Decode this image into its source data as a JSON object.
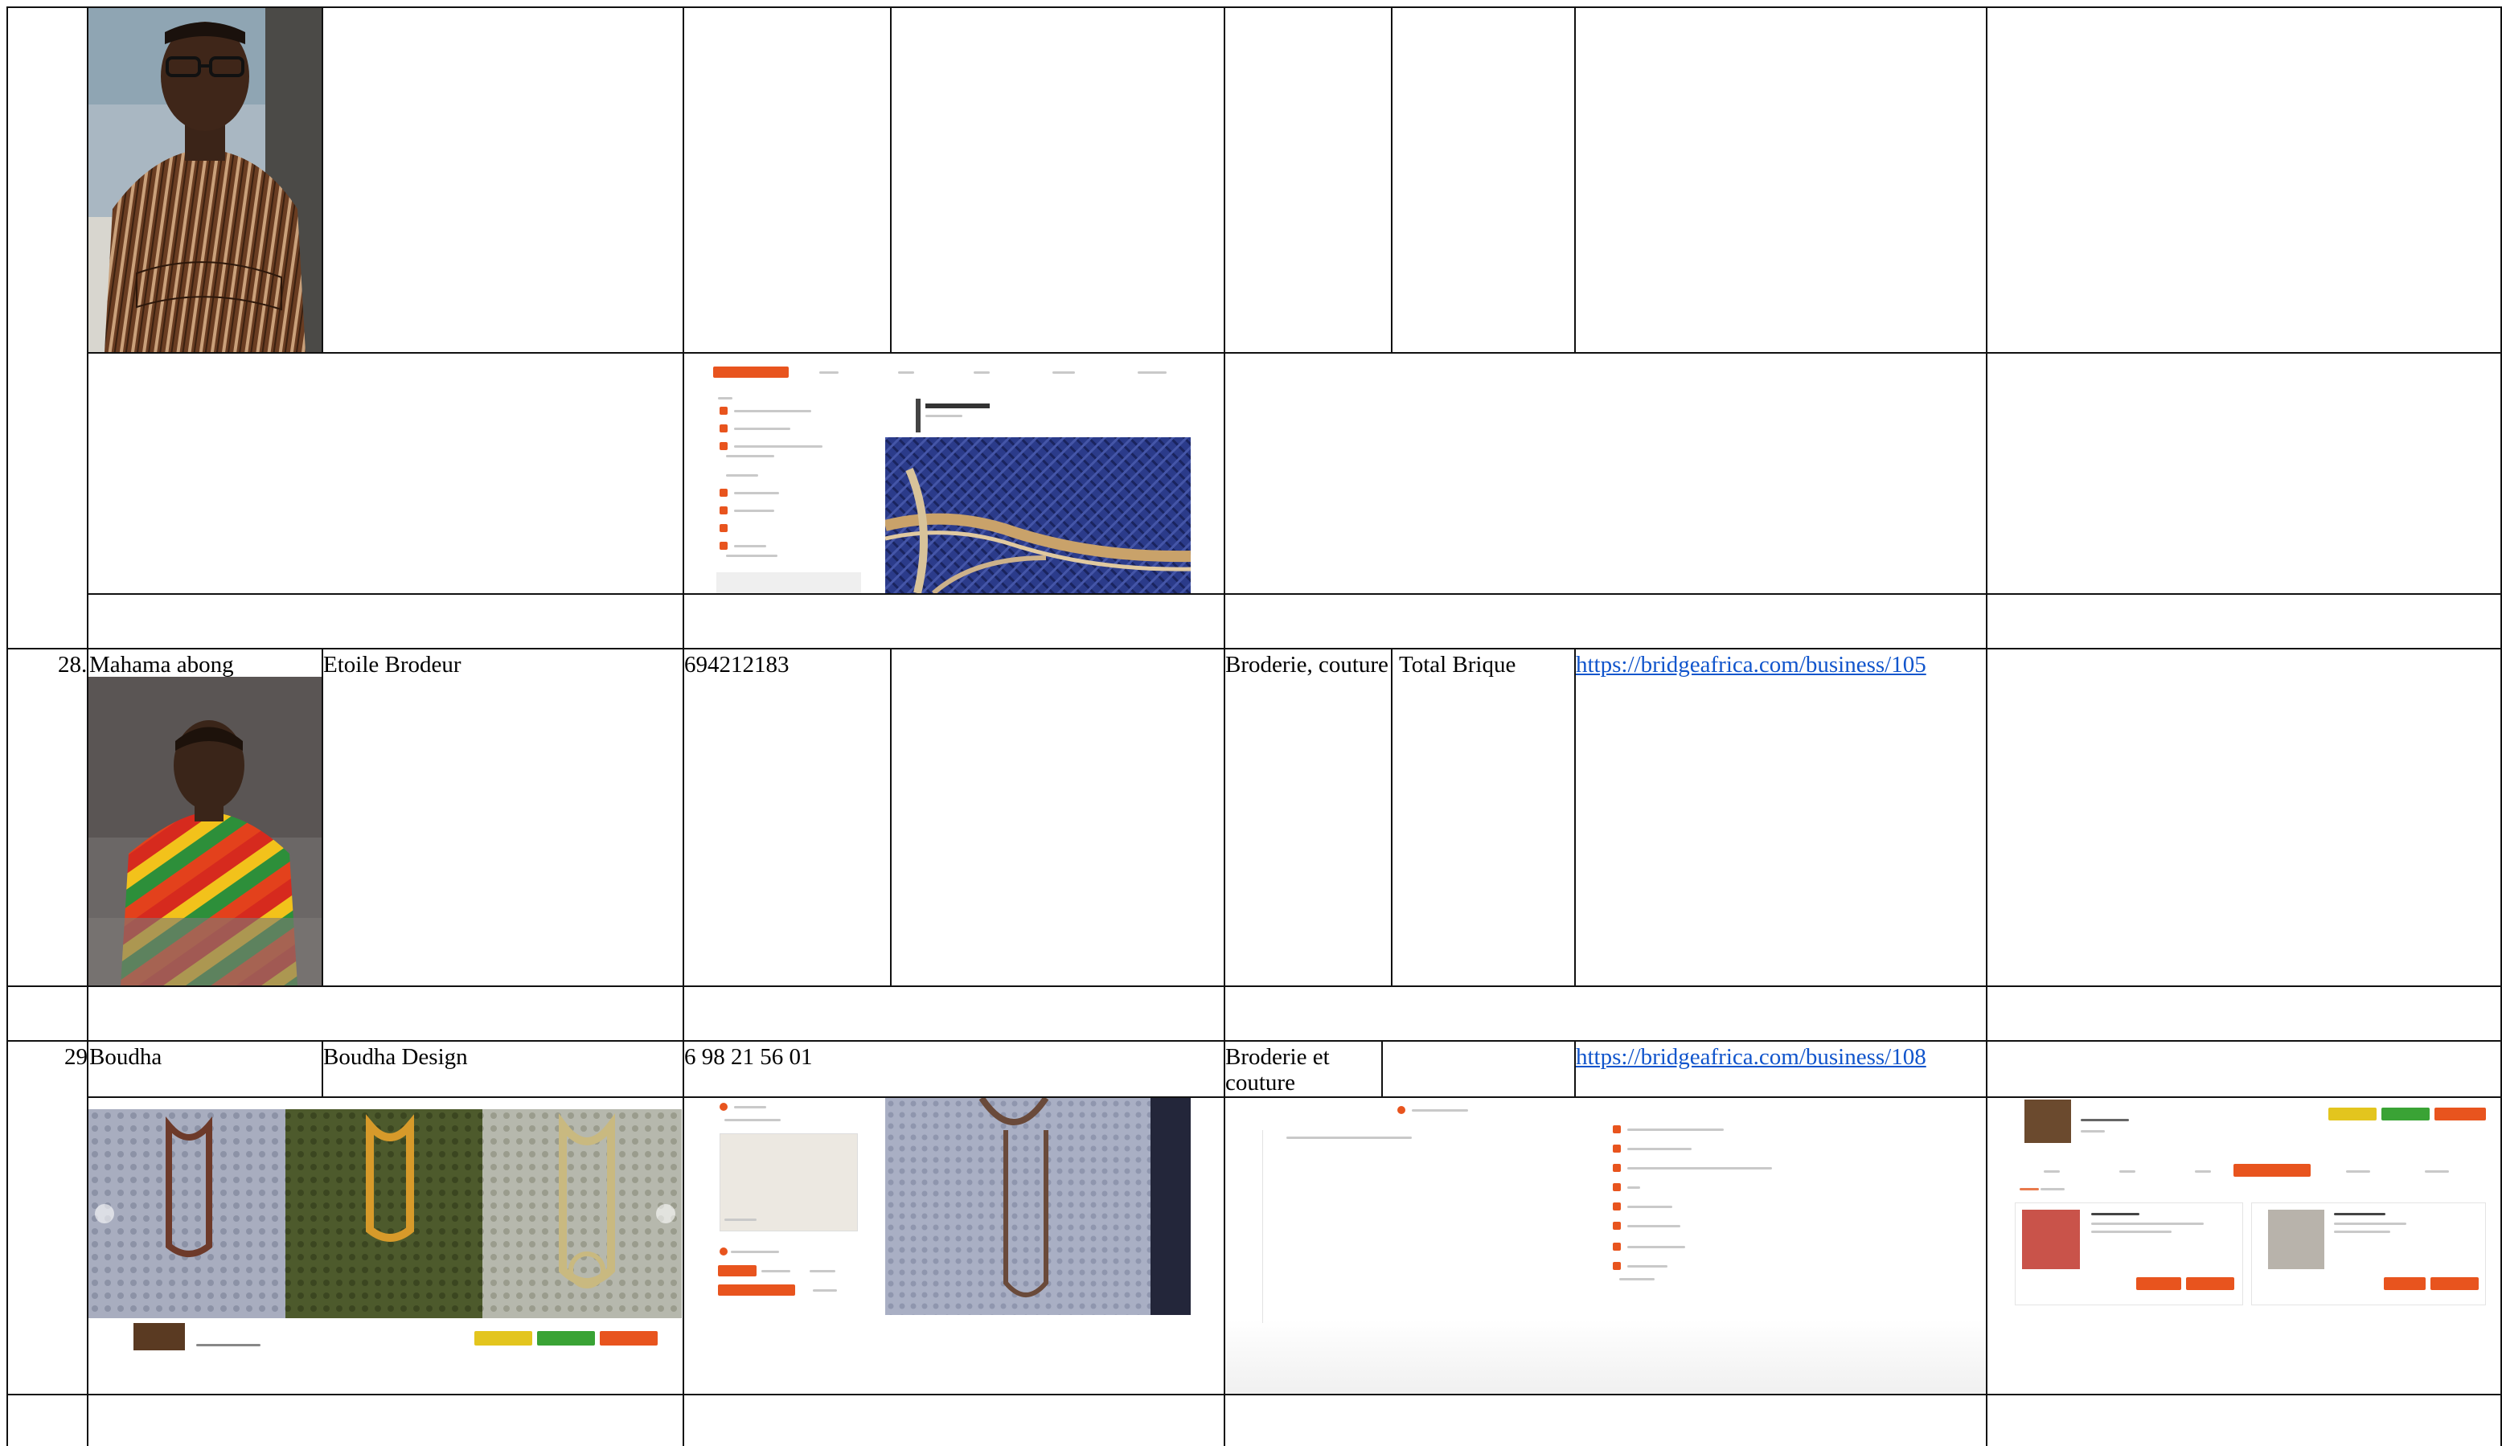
{
  "rows": [
    {
      "number": "28.",
      "name": "Mahama abong",
      "business": "Etoile Brodeur",
      "phone": "694212183",
      "activity": "Broderie, couture",
      "location": "Total Brique",
      "url": "https://bridgeafrica.com/business/105"
    },
    {
      "number": "29",
      "name": "Boudha",
      "business": "Boudha Design",
      "phone": "6 98 21 56 01",
      "activity_line1": "Broderie et",
      "activity_line2": "couture",
      "location": "",
      "url": "https://bridgeafrica.com/business/108"
    }
  ],
  "images": {
    "portrait_top": "person-photo",
    "portrait_28": "person-photo",
    "profile_shot_top": "business-profile-screenshot",
    "products_29": "embroidered-garments-photo",
    "profile_shot_29": "business-profile-screenshot",
    "about_shot_29": "business-about-screenshot",
    "marketplace_shot_29": "business-marketplace-screenshot"
  },
  "colors": {
    "accent": "#e8541e",
    "link": "#1155cc",
    "green": "#3aa335",
    "yellow": "#e3c51e"
  }
}
